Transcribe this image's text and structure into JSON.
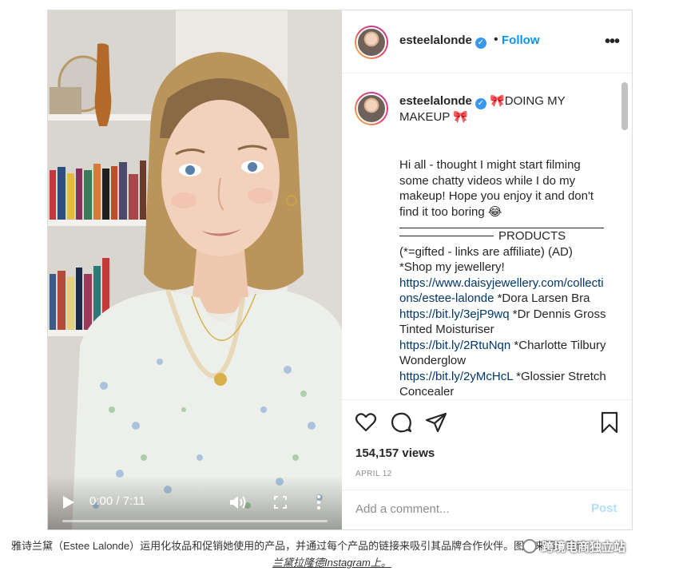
{
  "video": {
    "time": "0:00 / 7:11",
    "progress": 0.0
  },
  "header": {
    "username": "esteelalonde",
    "verified_mark": "✓",
    "separator": "•",
    "follow_label": "Follow",
    "more_label": "•••"
  },
  "caption": {
    "username": "esteelalonde",
    "title_emoji_1": "🎀",
    "title": "DOING MY MAKEUP",
    "title_emoji_2": "🎀",
    "intro": "Hi all - thought I might start filming some chatty videos while I do my makeup! Hope you enjoy it and don't find it too boring 😂",
    "products_label": "PRODUCTS",
    "gifted_note": "(*=gifted - links are affiliate) (AD)",
    "shop_line": "*Shop my jewellery!",
    "link_1": "https://www.daisyjewellery.com/collections/estee-lalonde",
    "item_1": " *Dora Larsen Bra",
    "link_2": "https://bit.ly/3ejP9wq",
    "item_2": " *Dr Dennis Gross Tinted Moisturiser",
    "link_3": "https://bit.ly/2RtuNqn",
    "item_3": " *Charlotte Tilbury Wonderglow",
    "link_4": "https://bit.ly/2yMcHcL",
    "item_4": " *Glossier Stretch Concealer"
  },
  "actions": {
    "like_icon": "heart-icon",
    "comment_icon": "comment-icon",
    "share_icon": "share-icon",
    "save_icon": "bookmark-icon",
    "views": "154,157 views",
    "date": "APRIL 12"
  },
  "comment": {
    "placeholder": "Add a comment...",
    "post_label": "Post"
  },
  "footnote": {
    "line1": "雅诗兰黛（Estee Lalonde）运用化妆品和促销她使用的产品，并通过每个产品的链接来吸引其品牌合作伙伴。图片来源：雅诗",
    "line2": "兰黛拉隆德Instagram上。",
    "watermark": "跨境电商独立站"
  },
  "colors": {
    "accent": "#0095f6",
    "verified": "#3897f0",
    "link": "#00376b",
    "muted": "#8e8e8e"
  }
}
